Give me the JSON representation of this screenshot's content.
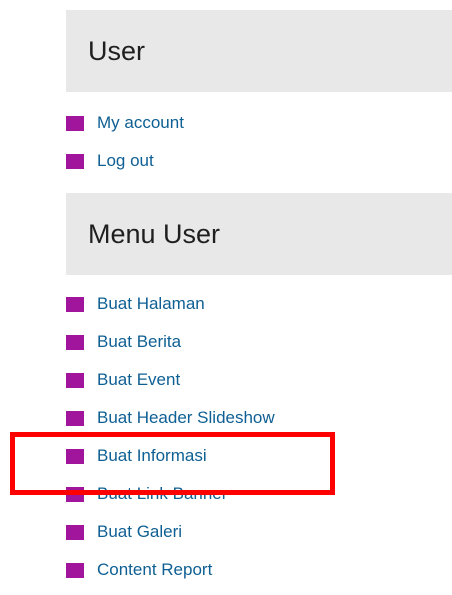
{
  "colors": {
    "bullet": "#a0159c",
    "link": "#0e5f93",
    "header_bg": "#e8e8e8",
    "highlight": "#ff0000"
  },
  "user_block": {
    "title": "User",
    "items": [
      {
        "label": "My account",
        "icon": "square-bullet-icon"
      },
      {
        "label": "Log out",
        "icon": "square-bullet-icon"
      }
    ]
  },
  "menu_user_block": {
    "title": "Menu User",
    "items": [
      {
        "label": "Buat Halaman",
        "icon": "square-bullet-icon"
      },
      {
        "label": "Buat Berita",
        "icon": "square-bullet-icon"
      },
      {
        "label": "Buat Event",
        "icon": "square-bullet-icon"
      },
      {
        "label": "Buat Header Slideshow",
        "icon": "square-bullet-icon"
      },
      {
        "label": "Buat Informasi",
        "icon": "square-bullet-icon",
        "highlighted": true
      },
      {
        "label": "Buat Link Banner",
        "icon": "square-bullet-icon"
      },
      {
        "label": "Buat Galeri",
        "icon": "square-bullet-icon"
      },
      {
        "label": "Content Report",
        "icon": "square-bullet-icon"
      }
    ]
  }
}
